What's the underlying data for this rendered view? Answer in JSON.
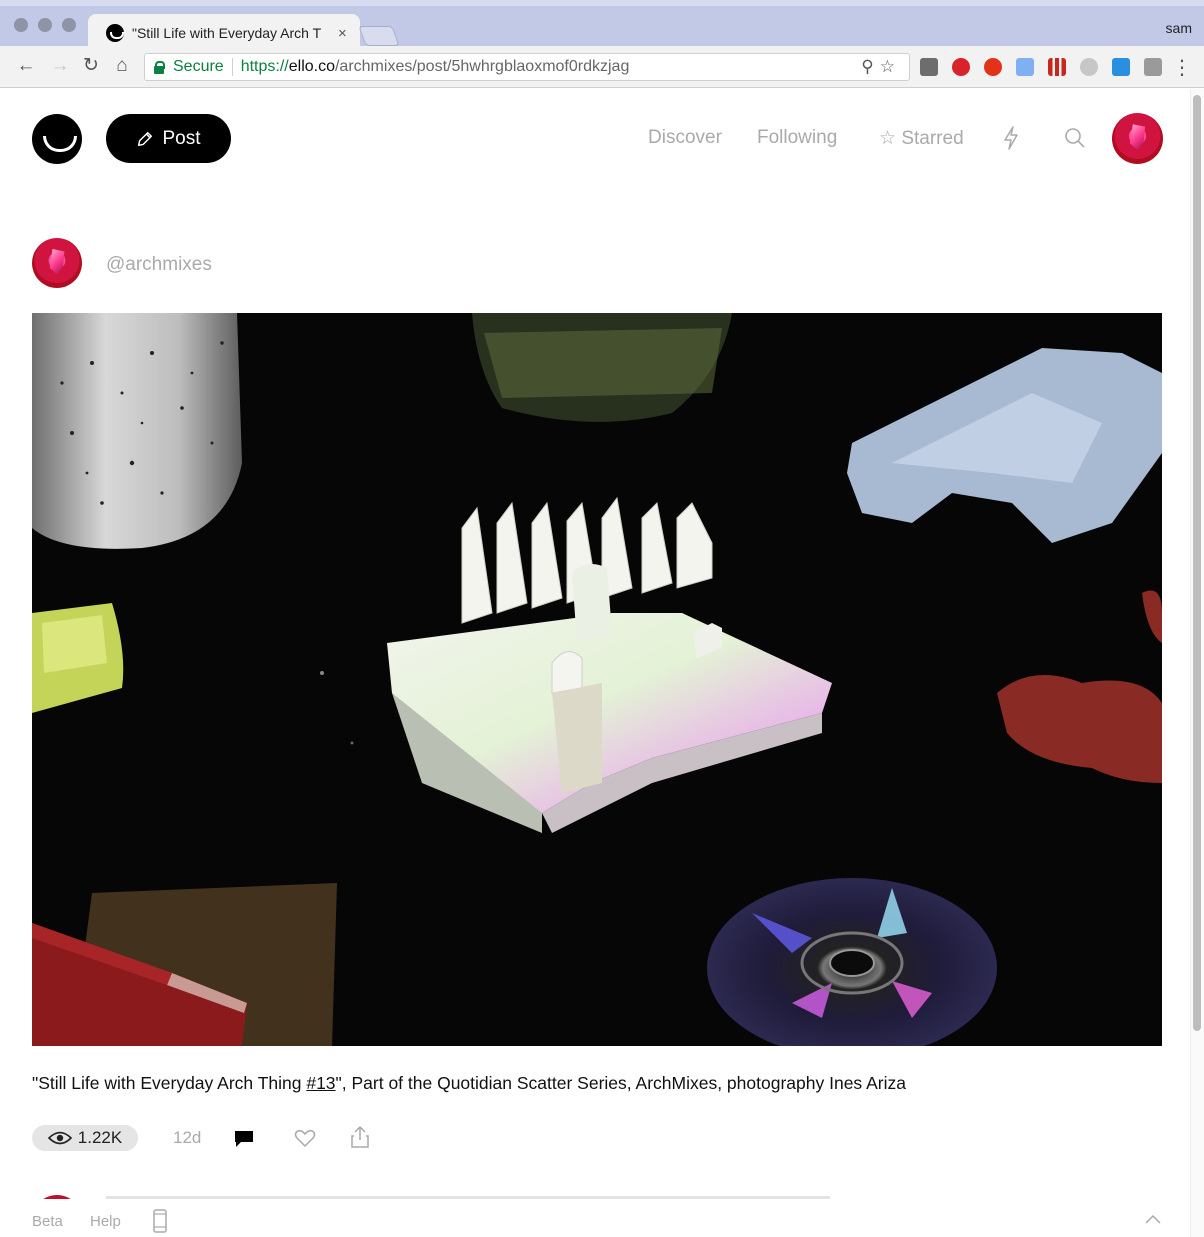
{
  "browser": {
    "tab_title": "\"Still Life with Everyday Arch T",
    "tab_close": "×",
    "profile_name": "sam",
    "secure_label": "Secure",
    "url_scheme": "https://",
    "url_host": "ello.co",
    "url_path": "/archmixes/post/5hwhrgblaoxmof0rdkzjag"
  },
  "header": {
    "post_label": "Post",
    "nav": {
      "discover": "Discover",
      "following": "Following",
      "starred": "Starred"
    }
  },
  "post": {
    "author": "@archmixes",
    "caption_before": "\"Still Life with Everyday Arch Thing ",
    "caption_link": "#13",
    "caption_after": "\", Part of the Quotidian Scatter Series, ArchMixes, photography Ines Ariza",
    "views": "1.22K",
    "time_ago": "12d"
  },
  "footer": {
    "beta": "Beta",
    "help": "Help"
  },
  "colors": {
    "secure_green": "#0b8043",
    "nav_gray": "#aaaaaa",
    "button_black": "#000000"
  }
}
